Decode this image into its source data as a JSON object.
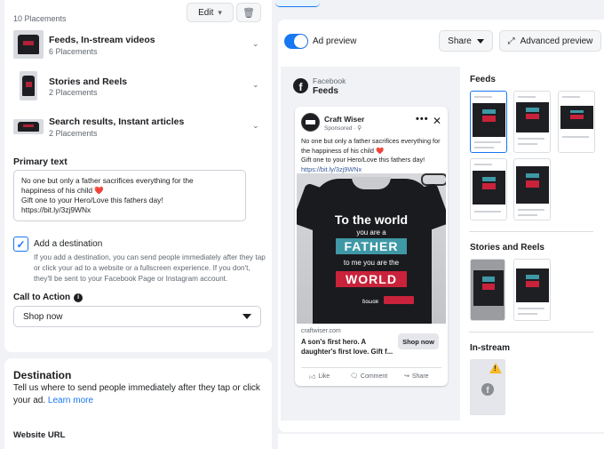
{
  "placements": {
    "count_label": "10 Placements",
    "edit_label": "Edit",
    "groups": [
      {
        "title": "Feeds, In-stream videos",
        "sub": "6 Placements"
      },
      {
        "title": "Stories and Reels",
        "sub": "2 Placements"
      },
      {
        "title": "Search results, Instant articles",
        "sub": "2 Placements"
      }
    ]
  },
  "primary_text": {
    "label": "Primary text",
    "line1": "No one but only a father sacrifices everything for the",
    "line2": "happiness of his child ❤️",
    "line3": "Gift one to your Hero/Love this fathers day!",
    "line4": "https://bit.ly/3zj9WNx"
  },
  "destination_toggle": {
    "label": "Add a destination",
    "help": "If you add a destination, you can send people immediately after they tap or click your ad to a website or a fullscreen experience. If you don't, they'll be sent to your Facebook Page or Instagram account."
  },
  "cta": {
    "label": "Call to Action",
    "value": "Shop now"
  },
  "destination_section": {
    "title": "Destination",
    "desc": "Tell us where to send people immediately after they tap or click your ad.",
    "learn_more": "Learn more",
    "website_label": "Website URL"
  },
  "preview_toolbar": {
    "toggle_label": "Ad preview",
    "share_label": "Share",
    "advanced_label": "Advanced preview"
  },
  "preview": {
    "platform": "Facebook",
    "placement": "Feeds",
    "page_name": "Craft Wiser",
    "sponsored": "Sponsored · ⚲",
    "text1": "No one but only a father sacrifices everything for the happiness of his child ❤️",
    "text2": "Gift one to your Hero/Love this fathers day!",
    "link": "https://bit.ly/3zj9WNx",
    "image_text": {
      "l1": "To the world",
      "l2": "you are a",
      "l3": "FATHER",
      "l4": "to me you are the",
      "l5": "WORLD",
      "brand": "ɓɑωɑʀ"
    },
    "domain": "craftwiser.com",
    "headline": "A son's first hero. A daughter's first love. Gift f...",
    "cta": "Shop now",
    "actions": [
      "Like",
      "Comment",
      "Share"
    ]
  },
  "gallery": {
    "feeds_label": "Feeds",
    "stories_label": "Stories and Reels",
    "instream_label": "In-stream"
  },
  "colors": {
    "accent": "#1877f2",
    "shirt": "#1e1f23",
    "red": "#c9233b",
    "teal": "#3f98a5"
  }
}
